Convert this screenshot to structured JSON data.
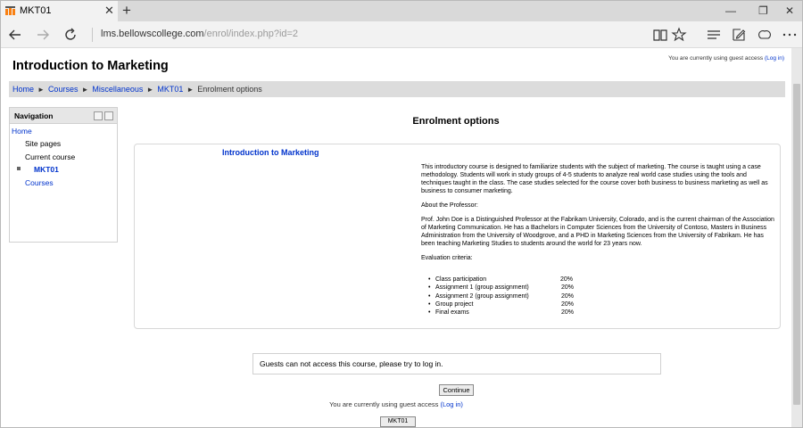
{
  "browser": {
    "tab_title": "MKT01",
    "tab_close": "✕",
    "new_tab": "+",
    "address": {
      "host": "lms.bellowscollege.com",
      "path": "/enrol/index.php?id=2"
    },
    "win_min": "—",
    "win_max": "❐",
    "win_close": "✕"
  },
  "header": {
    "page_title": "Introduction to Marketing",
    "login_prefix": "You are currently using guest access",
    "login_link": "(Log in)"
  },
  "breadcrumb": {
    "items": [
      "Home",
      "Courses",
      "Miscellaneous",
      "MKT01"
    ],
    "current": "Enrolment options",
    "separator": "►"
  },
  "navigation": {
    "title": "Navigation",
    "home": "Home",
    "site_pages": "Site pages",
    "current_course": "Current course",
    "course": "MKT01",
    "courses": "Courses"
  },
  "main": {
    "section_title": "Enrolment options",
    "course_name": "Introduction to Marketing",
    "summary_p1": "This introductory course is designed to familiarize students with the subject of marketing. The course is taught using a case methodology. Students will work in study groups of 4-5  students to analyze real world case studies using the tools and techniques taught in the class. The case studies selected for the course cover both business to business marketing as well as business to consumer marketing.",
    "summary_p2": "About the Professor:",
    "summary_p3": "Prof. John Doe is a Distinguished Professor at the Fabrikam University, Colorado, and is the current chairman of the Association of Marketing Communication. He has a Bachelors in Computer Sciences from the University of Contoso, Masters in Business Administration from the University of Woodgrove, and a PHD in Marketing Sciences from the University of Fabrikam. He has been teaching Marketing Studies to students around the world for 23 years now.",
    "summary_p4": "Evaluation criteria:",
    "criteria": [
      {
        "name": "Class participation",
        "value": "20%"
      },
      {
        "name": "Assignment 1 (group assignment)",
        "value": "20%"
      },
      {
        "name": "Assignment 2 (group assignment)",
        "value": "20%"
      },
      {
        "name": "Group project",
        "value": "20%"
      },
      {
        "name": "Final exams",
        "value": "20%"
      }
    ],
    "bullet": "•",
    "guest_message": "Guests can not access this course, please try to log in.",
    "continue_label": "Continue"
  },
  "footer": {
    "login_prefix": "You are currently using guest access",
    "login_link": "(Log in)",
    "course_button": "MKT01"
  },
  "colors": {
    "link": "#0033cc",
    "breadcrumb_bg": "#dcdcdc",
    "tab_bar_bg": "#d9d9d9"
  }
}
